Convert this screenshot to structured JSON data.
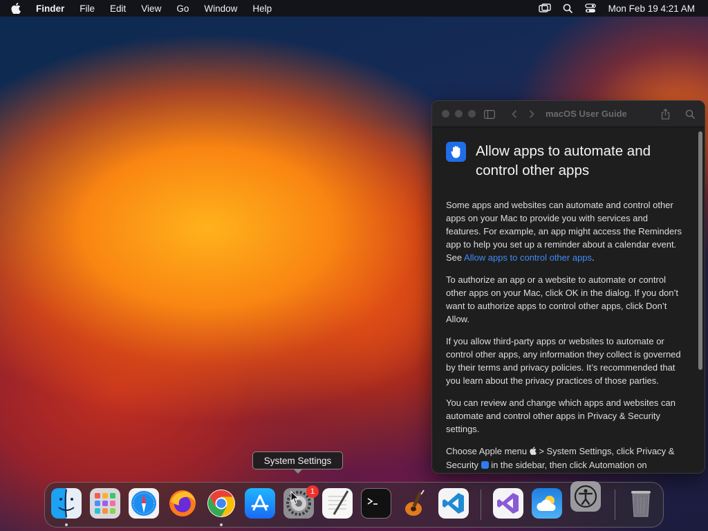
{
  "menubar": {
    "app_name": "Finder",
    "items": [
      "File",
      "Edit",
      "View",
      "Go",
      "Window",
      "Help"
    ],
    "clock": "Mon Feb 19  4:21 AM",
    "status_icons": [
      "screen-mirroring-icon",
      "spotlight-search-icon",
      "control-center-icon"
    ]
  },
  "window": {
    "title": "macOS User Guide",
    "heading": "Allow apps to automate and control other apps",
    "paragraphs": [
      {
        "text": "Some apps and websites can automate and control other apps on your Mac to provide you with services and features. For example, an app might access the Reminders app to help you set up a reminder about a calendar event. See ",
        "link": "Allow apps to control other apps",
        "after": "."
      },
      {
        "text": "To authorize an app or a website to automate or control other apps on your Mac, click OK in the dialog. If you don’t want to authorize apps to control other apps, click Don’t Allow."
      },
      {
        "text": "If you allow third-party apps or websites to automate or control other apps, any information they collect is governed by their terms and privacy policies. It’s recommended that you learn about the privacy practices of those parties."
      },
      {
        "text": "You can review and change which apps and websites can automate and control other apps in Privacy & Security settings."
      },
      {
        "text_before_apple": "Choose Apple menu ",
        "text_after_apple": " > System Settings, click Privacy & Security ",
        "text_after_shield": " in the sidebar, then click Automation on"
      }
    ]
  },
  "tooltip": "System Settings",
  "dock": {
    "apps": [
      {
        "name": "Finder",
        "icon": "finder-icon",
        "running": true
      },
      {
        "name": "Launchpad",
        "icon": "launchpad-icon",
        "running": false
      },
      {
        "name": "Safari",
        "icon": "safari-icon",
        "running": false
      },
      {
        "name": "Firefox",
        "icon": "firefox-icon",
        "running": false
      },
      {
        "name": "Google Chrome",
        "icon": "chrome-icon",
        "running": true
      },
      {
        "name": "App Store",
        "icon": "app-store-icon",
        "running": false
      },
      {
        "name": "System Settings",
        "icon": "system-settings-icon",
        "running": false,
        "badge": "1"
      },
      {
        "name": "TextEdit",
        "icon": "textedit-icon",
        "running": false
      },
      {
        "name": "Terminal",
        "icon": "terminal-icon",
        "running": false
      },
      {
        "name": "GarageBand",
        "icon": "garageband-icon",
        "running": false
      },
      {
        "name": "Visual Studio Code",
        "icon": "vscode-icon",
        "running": false
      },
      {
        "name": "Visual Studio",
        "icon": "visual-studio-icon",
        "running": false
      },
      {
        "name": "Weather",
        "icon": "weather-icon",
        "running": false
      },
      {
        "name": "Accessibility",
        "icon": "accessibility-icon",
        "running": false
      },
      {
        "name": "Trash",
        "icon": "trash-icon",
        "running": false
      }
    ],
    "system_settings_badge": "1"
  },
  "colors": {
    "link": "#3e8cf3",
    "accent": "#1f6ee8",
    "badge": "#f0322d"
  }
}
